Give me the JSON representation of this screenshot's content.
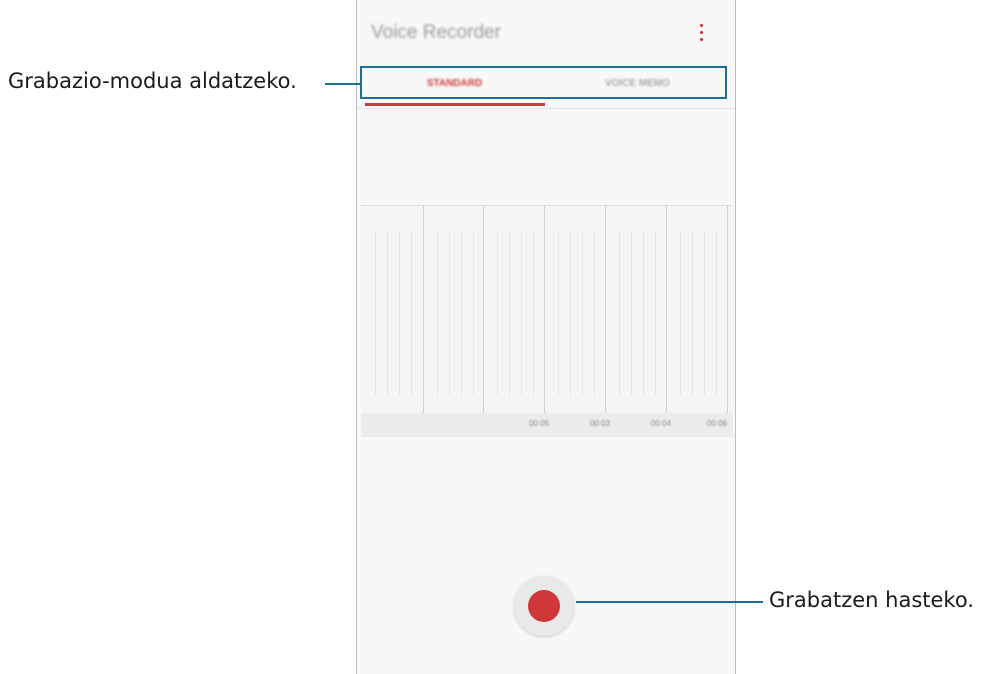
{
  "app": {
    "title": "Voice Recorder",
    "menu_icon": "more-vertical-icon",
    "accent_color": "#cc3b3b"
  },
  "tabs": [
    {
      "label": "STANDARD",
      "selected": true
    },
    {
      "label": "VOICE MEMO",
      "selected": false
    }
  ],
  "timeline": {
    "labels": [
      "00:05",
      "00:03",
      "00:04",
      "00:06"
    ]
  },
  "record_button": {
    "icon": "record-icon",
    "color": "#d0373a"
  },
  "callouts": {
    "mode_switch": "Grabazio-modua aldatzeko.",
    "start_recording": "Grabatzen hasteko."
  },
  "annotation_color": "#1d6f98"
}
